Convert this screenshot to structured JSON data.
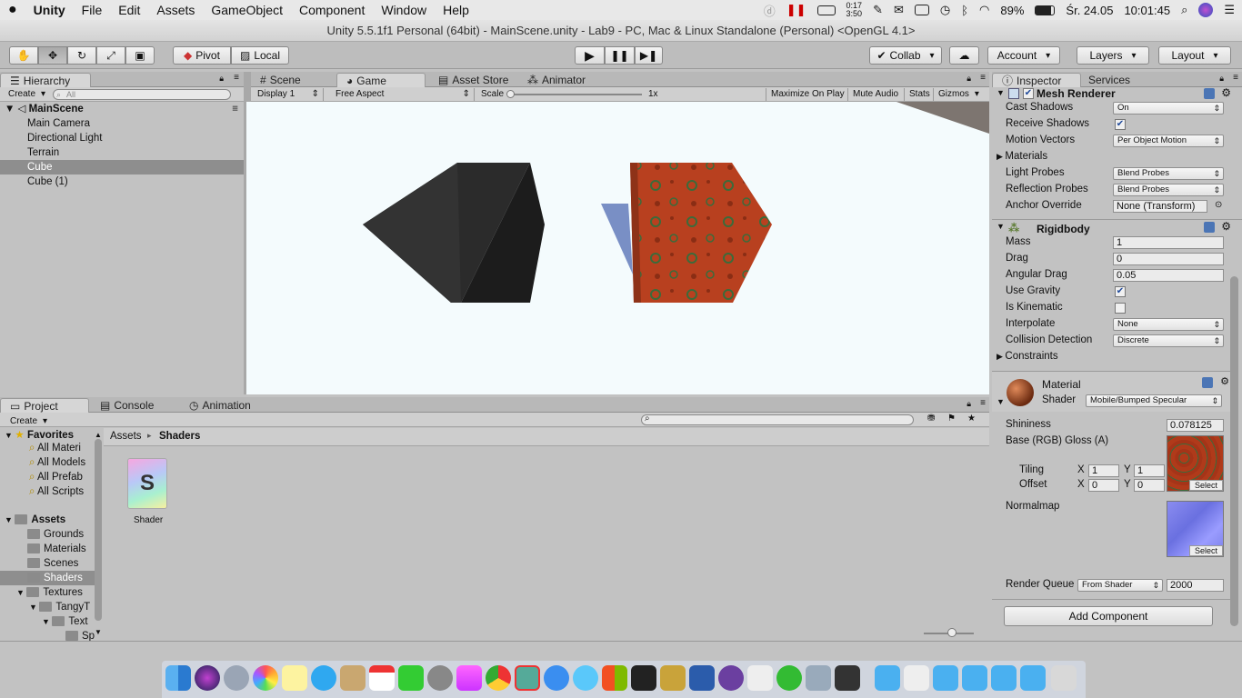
{
  "menubar": {
    "apple": "",
    "app": "Unity",
    "items": [
      "File",
      "Edit",
      "Assets",
      "GameObject",
      "Component",
      "Window",
      "Help"
    ],
    "timer": "0:17\n3:50",
    "battery": "89%",
    "date": "Śr. 24.05",
    "time": "10:01:45"
  },
  "window_title": "Unity 5.5.1f1 Personal (64bit) - MainScene.unity - Lab9 - PC, Mac & Linux Standalone (Personal) <OpenGL 4.1>",
  "toolbar": {
    "pivot": "Pivot",
    "local": "Local",
    "collab": "Collab",
    "account": "Account",
    "layers": "Layers",
    "layout": "Layout"
  },
  "hierarchy": {
    "tab": "Hierarchy",
    "create": "Create",
    "search_placeholder": "All",
    "scene": "MainScene",
    "items": [
      "Main Camera",
      "Directional Light",
      "Terrain",
      "Cube",
      "Cube (1)"
    ]
  },
  "center_tabs": [
    "Scene",
    "Game",
    "Asset Store",
    "Animator"
  ],
  "game": {
    "display": "Display 1",
    "aspect": "Free Aspect",
    "scale_label": "Scale",
    "scale_value": "1x",
    "maximize": "Maximize On Play",
    "mute": "Mute Audio",
    "stats": "Stats",
    "gizmos": "Gizmos"
  },
  "inspector": {
    "tab": "Inspector",
    "tab2": "Services",
    "mesh_renderer": {
      "title": "Mesh Renderer",
      "cast_shadows": {
        "label": "Cast Shadows",
        "value": "On"
      },
      "receive_shadows": {
        "label": "Receive Shadows"
      },
      "motion_vectors": {
        "label": "Motion Vectors",
        "value": "Per Object Motion"
      },
      "materials": "Materials",
      "light_probes": {
        "label": "Light Probes",
        "value": "Blend Probes"
      },
      "reflection_probes": {
        "label": "Reflection Probes",
        "value": "Blend Probes"
      },
      "anchor_override": {
        "label": "Anchor Override",
        "value": "None (Transform)"
      }
    },
    "rigidbody": {
      "title": "Rigidbody",
      "mass": {
        "label": "Mass",
        "value": "1"
      },
      "drag": {
        "label": "Drag",
        "value": "0"
      },
      "angular_drag": {
        "label": "Angular Drag",
        "value": "0.05"
      },
      "use_gravity": {
        "label": "Use Gravity"
      },
      "is_kinematic": {
        "label": "Is Kinematic"
      },
      "interpolate": {
        "label": "Interpolate",
        "value": "None"
      },
      "collision": {
        "label": "Collision Detection",
        "value": "Discrete"
      },
      "constraints": "Constraints"
    },
    "material": {
      "title": "Material",
      "shader_label": "Shader",
      "shader_value": "Mobile/Bumped Specular",
      "shininess": {
        "label": "Shininess",
        "value": "0.078125"
      },
      "base": "Base (RGB) Gloss (A)",
      "tiling": "Tiling",
      "offset": "Offset",
      "x": "X",
      "y": "Y",
      "tiling_x": "1",
      "tiling_y": "1",
      "offset_x": "0",
      "offset_y": "0",
      "select": "Select",
      "normalmap": "Normalmap",
      "render_queue": {
        "label": "Render Queue",
        "mode": "From Shader",
        "value": "2000"
      }
    },
    "add_component": "Add Component"
  },
  "project": {
    "tabs": [
      "Project",
      "Console",
      "Animation"
    ],
    "create": "Create",
    "favorites": {
      "title": "Favorites",
      "items": [
        "All Materi",
        "All Models",
        "All Prefab",
        "All Scripts"
      ]
    },
    "assets": {
      "title": "Assets",
      "items": [
        "Grounds",
        "Materials",
        "Scenes",
        "Shaders",
        "Textures",
        "TangyT",
        "Text",
        "Sp"
      ]
    },
    "breadcrumb": [
      "Assets",
      "Shaders"
    ],
    "file": "Shader",
    "file_glyph": "S"
  }
}
